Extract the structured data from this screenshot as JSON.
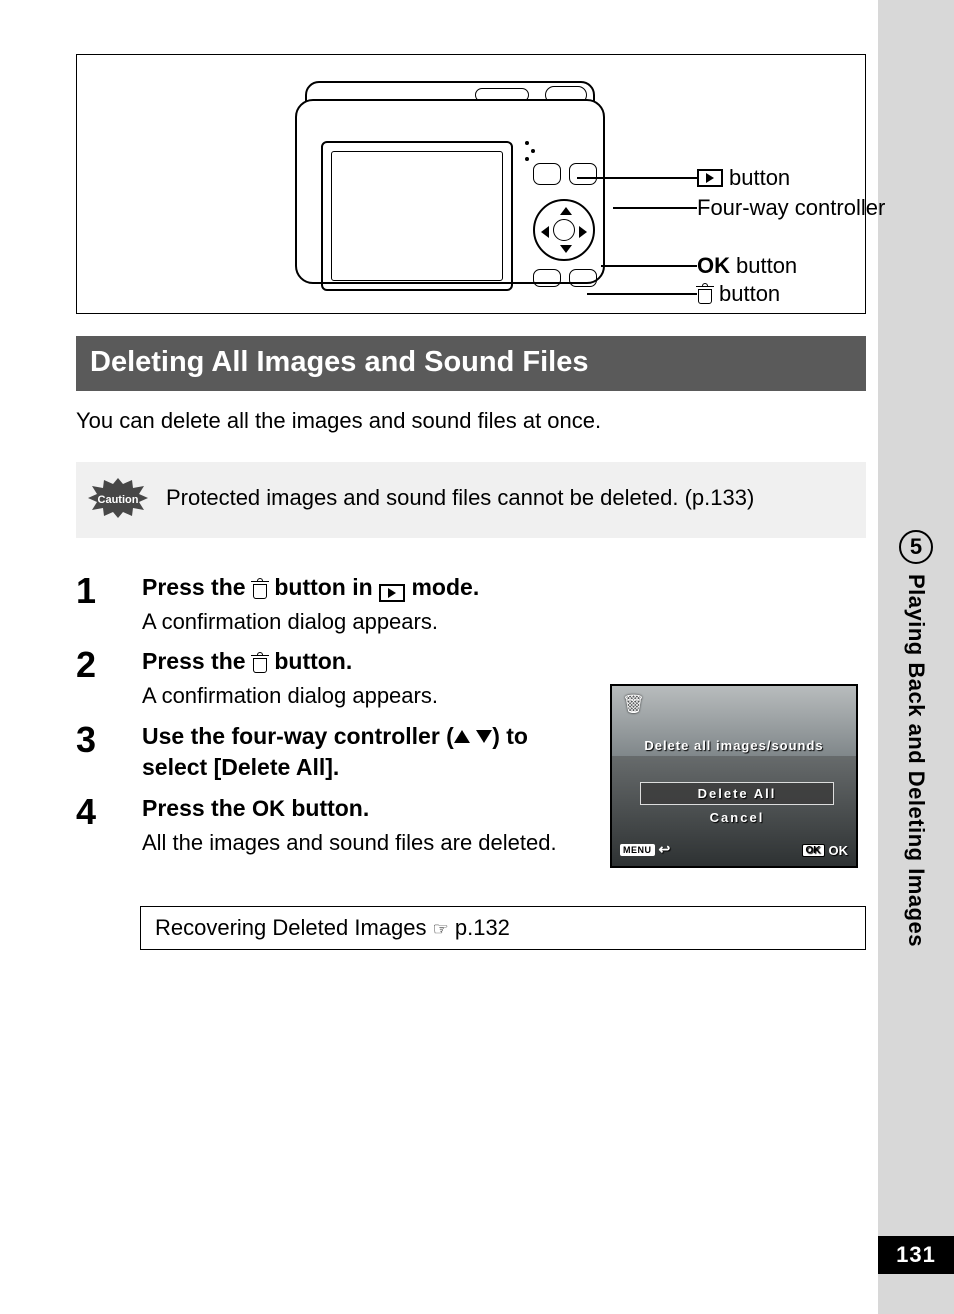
{
  "diagram_labels": {
    "play_button": "button",
    "fourway": "Four-way controller",
    "ok_button": "button",
    "ok_prefix": "OK",
    "trash_button": "button"
  },
  "section_title": "Deleting All Images and Sound Files",
  "intro_text": "You can delete all the images and sound files at once.",
  "caution_label": "Caution",
  "caution_text": "Protected images and sound files cannot be deleted. (p.133)",
  "steps": [
    {
      "num": "1",
      "title_pre": "Press the ",
      "title_mid": " button in ",
      "title_post": " mode.",
      "desc": "A confirmation dialog appears."
    },
    {
      "num": "2",
      "title_pre": "Press the ",
      "title_post": " button.",
      "desc": "A confirmation dialog appears."
    },
    {
      "num": "3",
      "title_pre": "Use the four-way controller (",
      "title_post": ") to select [Delete All]."
    },
    {
      "num": "4",
      "title_pre": "Press the ",
      "title_ok": "OK",
      "title_post": " button.",
      "desc": "All the images and sound files are deleted."
    }
  ],
  "lcd": {
    "prompt": "Delete all images/sounds",
    "option_delete": "Delete All",
    "option_cancel": "Cancel",
    "menu": "MENU",
    "ok_box": "OK",
    "ok_text": "OK"
  },
  "reference": {
    "text_pre": "Recovering Deleted Images ",
    "page_ref": "p.132"
  },
  "side_tab": {
    "chapter": "5",
    "title": "Playing Back and Deleting Images"
  },
  "page_number": "131"
}
